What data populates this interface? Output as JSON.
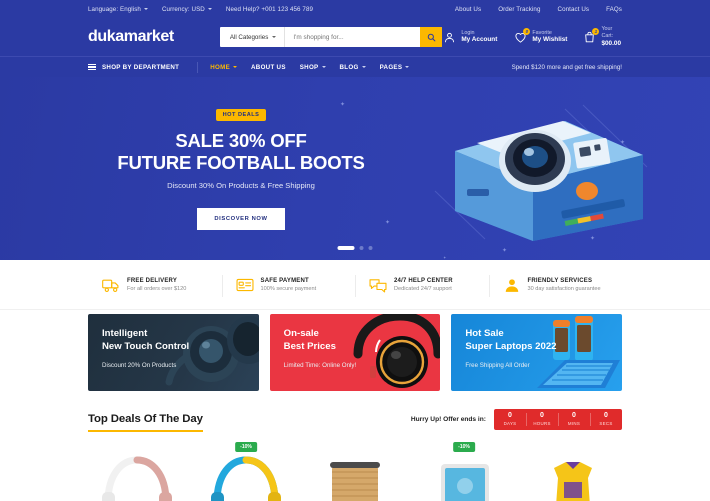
{
  "topbar": {
    "language": "Language: English",
    "currency": "Currency: USD",
    "help": "Need Help? +001 123 456 789",
    "links": [
      "About Us",
      "Order Tracking",
      "Contact Us",
      "FAQs"
    ]
  },
  "header": {
    "logo": "dukamarket",
    "search": {
      "category": "All Categories",
      "placeholder": "I'm shopping for...",
      "value": "",
      "button_icon": "search-icon"
    },
    "account": {
      "line1": "Login",
      "line2": "My Account",
      "icon": "user-icon"
    },
    "wishlist": {
      "line1": "Favorite",
      "line2": "My Wishlist",
      "count": "0",
      "icon": "heart-icon"
    },
    "cart": {
      "line1": "Your Cart:",
      "line2": "$00.00",
      "count": "1",
      "icon": "bag-icon"
    }
  },
  "nav": {
    "department": "SHOP BY DEPARTMENT",
    "menu_icon": "hamburger-icon",
    "links": [
      {
        "label": "HOME",
        "caret": true,
        "active": true
      },
      {
        "label": "ABOUT US",
        "caret": false,
        "active": false
      },
      {
        "label": "SHOP",
        "caret": true,
        "active": false
      },
      {
        "label": "BLOG",
        "caret": true,
        "active": false
      },
      {
        "label": "PAGES",
        "caret": true,
        "active": false
      }
    ],
    "note": "Spend $120 more and get free shipping!"
  },
  "hero": {
    "badge": "HOT DEALS",
    "title_line1": "SALE 30% OFF",
    "title_line2": "FUTURE FOOTBALL BOOTS",
    "subtitle": "Discount 30% On Products & Free Shipping",
    "button": "DISCOVER NOW",
    "image_name": "instant-camera-illustration",
    "slides_total": 3,
    "active_slide": 1
  },
  "features": [
    {
      "icon": "delivery-truck-icon",
      "title": "FREE DELIVERY",
      "desc": "For all orders over $120"
    },
    {
      "icon": "credit-card-icon",
      "title": "SAFE PAYMENT",
      "desc": "100% secure payment"
    },
    {
      "icon": "chat-bubbles-icon",
      "title": "24/7 HELP CENTER",
      "desc": "Dedicated 24/7 support"
    },
    {
      "icon": "support-agent-icon",
      "title": "FRIENDLY SERVICES",
      "desc": "30 day satisfaction guarantee"
    }
  ],
  "promos": [
    {
      "line1": "Intelligent",
      "line2": "New Touch Control",
      "sub": "Discount 20% On Products",
      "art": "headphones-dark-art"
    },
    {
      "line1": "On-sale",
      "line2": "Best Prices",
      "sub": "Limited Time: Online Only!",
      "art": "headphone-red-art"
    },
    {
      "line1": "Hot Sale",
      "line2": "Super Laptops 2022",
      "sub": "Free Shipping All Order",
      "art": "laptop-blue-art"
    }
  ],
  "deals": {
    "title": "Top Deals Of The Day",
    "countdown_label": "Hurry Up! Offer ends in:",
    "countdown": [
      {
        "value": "0",
        "unit": "DAYS"
      },
      {
        "value": "0",
        "unit": "HOURS"
      },
      {
        "value": "0",
        "unit": "MINS"
      },
      {
        "value": "0",
        "unit": "SECS"
      }
    ]
  },
  "products": [
    {
      "art": "headphones-pink-white",
      "badge": ""
    },
    {
      "art": "headphones-blue-yellow",
      "badge": "-10%"
    },
    {
      "art": "wicker-basket-bag",
      "badge": ""
    },
    {
      "art": "tablet-device",
      "badge": "-10%"
    },
    {
      "art": "yellow-jersey",
      "badge": ""
    }
  ],
  "colors": {
    "brand_blue": "#2b3aa3",
    "accent_yellow": "#fcb800",
    "promo_red": "#ea3642",
    "promo_blue": "#1686d8",
    "countdown_red": "#e02b2b",
    "badge_green": "#2bab4d"
  }
}
